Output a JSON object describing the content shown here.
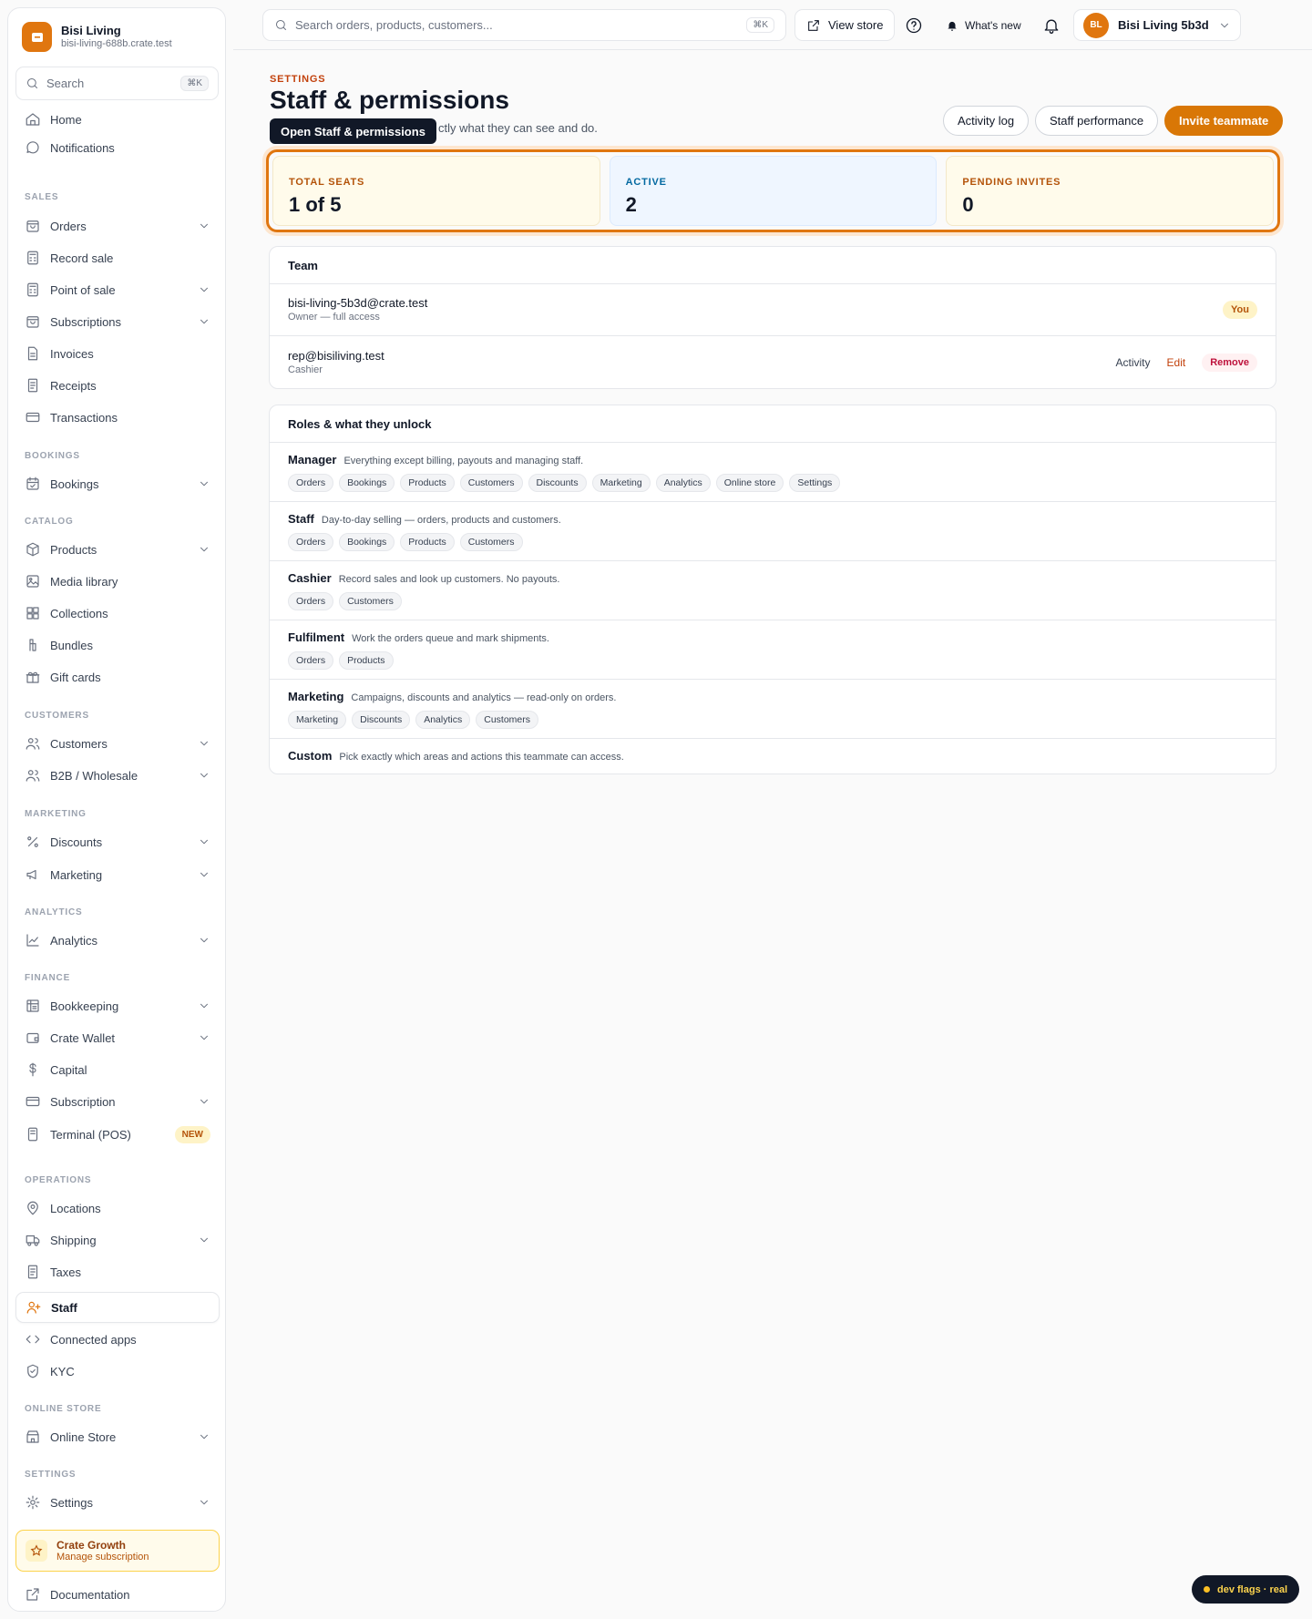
{
  "brand": {
    "name": "Bisi Living",
    "domain": "bisi-living-688b.crate.test"
  },
  "sidebar_search": {
    "label": "Search",
    "shortcut": "⌘K"
  },
  "sidebar": {
    "home": "Home",
    "notifications": "Notifications",
    "sales_title": "SALES",
    "orders": "Orders",
    "record_sale": "Record sale",
    "point_of_sale": "Point of sale",
    "subscriptions": "Subscriptions",
    "invoices": "Invoices",
    "receipts": "Receipts",
    "transactions": "Transactions",
    "bookings_title": "BOOKINGS",
    "bookings": "Bookings",
    "catalog_title": "CATALOG",
    "products": "Products",
    "media_library": "Media library",
    "collections": "Collections",
    "bundles": "Bundles",
    "gift_cards": "Gift cards",
    "customers_title": "CUSTOMERS",
    "customers": "Customers",
    "b2b": "B2B / Wholesale",
    "marketing_title": "MARKETING",
    "discounts": "Discounts",
    "marketing": "Marketing",
    "analytics_title": "ANALYTICS",
    "analytics": "Analytics",
    "finance_title": "FINANCE",
    "bookkeeping": "Bookkeeping",
    "crate_wallet": "Crate Wallet",
    "capital": "Capital",
    "subscription": "Subscription",
    "terminal": "Terminal (POS)",
    "new_badge": "NEW",
    "operations_title": "OPERATIONS",
    "locations": "Locations",
    "shipping": "Shipping",
    "taxes": "Taxes",
    "staff": "Staff",
    "connected_apps": "Connected apps",
    "kyc": "KYC",
    "online_store_title": "ONLINE STORE",
    "online_store": "Online Store",
    "settings_title": "SETTINGS",
    "settings": "Settings",
    "growth_title": "Crate Growth",
    "growth_sub": "Manage subscription",
    "documentation": "Documentation"
  },
  "topbar": {
    "search_placeholder": "Search orders, products, customers...",
    "search_shortcut": "⌘K",
    "view_store": "View store",
    "whats_new": "What's new",
    "avatar_initials": "BL",
    "account_name": "Bisi Living 5b3d"
  },
  "page": {
    "eyebrow": "SETTINGS",
    "title": "Staff & permissions",
    "subtitle_fragment": "ctly what they can see and do.",
    "tooltip": "Open Staff & permissions",
    "activity_log": "Activity log",
    "staff_performance": "Staff performance",
    "invite": "Invite teammate"
  },
  "stats": [
    {
      "label": "TOTAL SEATS",
      "value": "1 of 5",
      "color": "#b45309",
      "bg": "#fffbeb"
    },
    {
      "label": "ACTIVE",
      "value": "2",
      "color": "#0369a1",
      "bg": "#eff6ff"
    },
    {
      "label": "PENDING INVITES",
      "value": "0",
      "color": "#b45309",
      "bg": "#fffbeb"
    }
  ],
  "team": {
    "title": "Team",
    "members": [
      {
        "email": "bisi-living-5b3d@crate.test",
        "role": "Owner — full access",
        "badge": "You"
      },
      {
        "email": "rep@bisiliving.test",
        "role": "Cashier",
        "activity": "Activity",
        "edit": "Edit",
        "remove": "Remove"
      }
    ]
  },
  "roles": {
    "title": "Roles & what they unlock",
    "items": [
      {
        "name": "Manager",
        "desc": "Everything except billing, payouts and managing staff.",
        "chips": [
          "Orders",
          "Bookings",
          "Products",
          "Customers",
          "Discounts",
          "Marketing",
          "Analytics",
          "Online store",
          "Settings"
        ]
      },
      {
        "name": "Staff",
        "desc": "Day-to-day selling — orders, products and customers.",
        "chips": [
          "Orders",
          "Bookings",
          "Products",
          "Customers"
        ]
      },
      {
        "name": "Cashier",
        "desc": "Record sales and look up customers. No payouts.",
        "chips": [
          "Orders",
          "Customers"
        ]
      },
      {
        "name": "Fulfilment",
        "desc": "Work the orders queue and mark shipments.",
        "chips": [
          "Orders",
          "Products"
        ]
      },
      {
        "name": "Marketing",
        "desc": "Campaigns, discounts and analytics — read-only on orders.",
        "chips": [
          "Marketing",
          "Discounts",
          "Analytics",
          "Customers"
        ]
      },
      {
        "name": "Custom",
        "desc": "Pick exactly which areas and actions this teammate can access.",
        "chips": []
      }
    ]
  },
  "dev_flags": "dev flags · real",
  "colors": {
    "accent": "#e0760f",
    "danger": "#be123c"
  }
}
